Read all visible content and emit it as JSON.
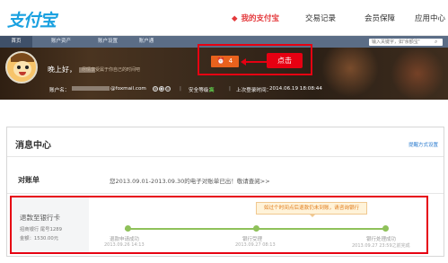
{
  "header": {
    "logo": "支付宝",
    "nav": [
      {
        "label": "我的支付宝",
        "active": true
      },
      {
        "label": "交易记录"
      },
      {
        "label": "会员保障"
      },
      {
        "label": "应用中心"
      }
    ],
    "nav_dot": "◆"
  },
  "tabs": [
    "首页",
    "账户资产",
    "账户设置",
    "账户通"
  ],
  "search": {
    "placeholder": "输入关键字，如\"余额宝\""
  },
  "account": {
    "greeting": "晚上好，",
    "tip": "尽情享受属于你自己的时间吧",
    "account_label": "账户名：",
    "account_suffix": "@foxmail.com",
    "security_label": "安全等级：",
    "security_value": "高",
    "last_login_label": "上次登录时间：",
    "last_login_value": "2014.06.19 18:08:44",
    "message_count": "4",
    "click_tag": "点击"
  },
  "message_center": {
    "title": "消息中心",
    "setting_link": "提醒方式设置",
    "statement_label": "对账单",
    "statement_text": "您2013.09.01-2013.09.30的电子对账单已出！敬请查阅>>",
    "refund": {
      "title": "退款至银行卡",
      "bank": "招商银行 尾号1289",
      "amount": "金额：1530.00元"
    },
    "tooltip": "如过个时间点后退款仍未到账，请咨询银行",
    "steps": [
      {
        "label": "退款申请成功",
        "time": "2013.09.26 14:13"
      },
      {
        "label": "银行受理",
        "time": "2013.09.27 08:13"
      },
      {
        "label": "银行处理成功",
        "time": "2013.09.27 23:59之前完成"
      }
    ]
  },
  "colors": {
    "brand_blue": "#1aa1e0",
    "accent_red": "#e60012",
    "orange": "#e9621d",
    "progress_green": "#8fc15a"
  }
}
